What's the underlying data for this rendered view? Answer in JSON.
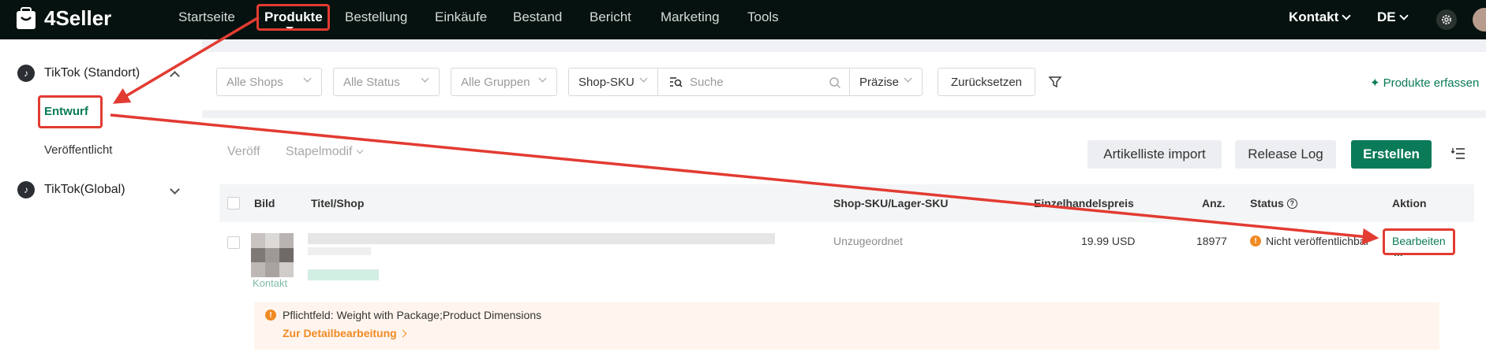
{
  "app": {
    "name": "4Seller"
  },
  "nav": {
    "items": [
      "Startseite",
      "Produkte",
      "Bestellung",
      "Einkäufe",
      "Bestand",
      "Bericht",
      "Marketing",
      "Tools"
    ],
    "active": "Produkte",
    "contact": "Kontakt",
    "language": "DE"
  },
  "sidebar": {
    "groups": [
      {
        "label": "TikTok (Standort)",
        "expanded": true,
        "items": [
          "Entwurf",
          "Veröffentlicht"
        ],
        "active_item": "Entwurf"
      },
      {
        "label": "TikTok(Global)",
        "expanded": false
      }
    ]
  },
  "filters": {
    "shops": "Alle Shops",
    "status": "Alle Status",
    "groups": "Alle Gruppen",
    "sku_type": "Shop-SKU",
    "search_placeholder": "Suche",
    "match": "Präzise",
    "reset": "Zurücksetzen",
    "produkte_erfassen": "Produkte erfassen"
  },
  "toolbar": {
    "publish": "Veröff",
    "batch_modify": "Stapelmodif",
    "import": "Artikelliste import",
    "release_log": "Release Log",
    "create": "Erstellen"
  },
  "table": {
    "columns": [
      "Bild",
      "Titel/Shop",
      "Shop-SKU/Lager-SKU",
      "Einzelhandelspreis",
      "Anz.",
      "Status",
      "Aktion"
    ],
    "rows": [
      {
        "thumb_caption": "Kontakt",
        "sku": "Unzugeordnet",
        "price": "19.99 USD",
        "quantity": "18977",
        "status": "Nicht veröffentlichbar",
        "action": "Bearbeiten",
        "more": "..."
      }
    ],
    "warning": {
      "text": "Pflichtfeld: Weight with Package;Product Dimensions",
      "link": "Zur Detailbearbeitung"
    }
  },
  "colors": {
    "brand_green": "#0a7a58",
    "nav_bg": "#05120f",
    "annotation_red": "#e23b32",
    "warning_orange": "#f08a24"
  }
}
